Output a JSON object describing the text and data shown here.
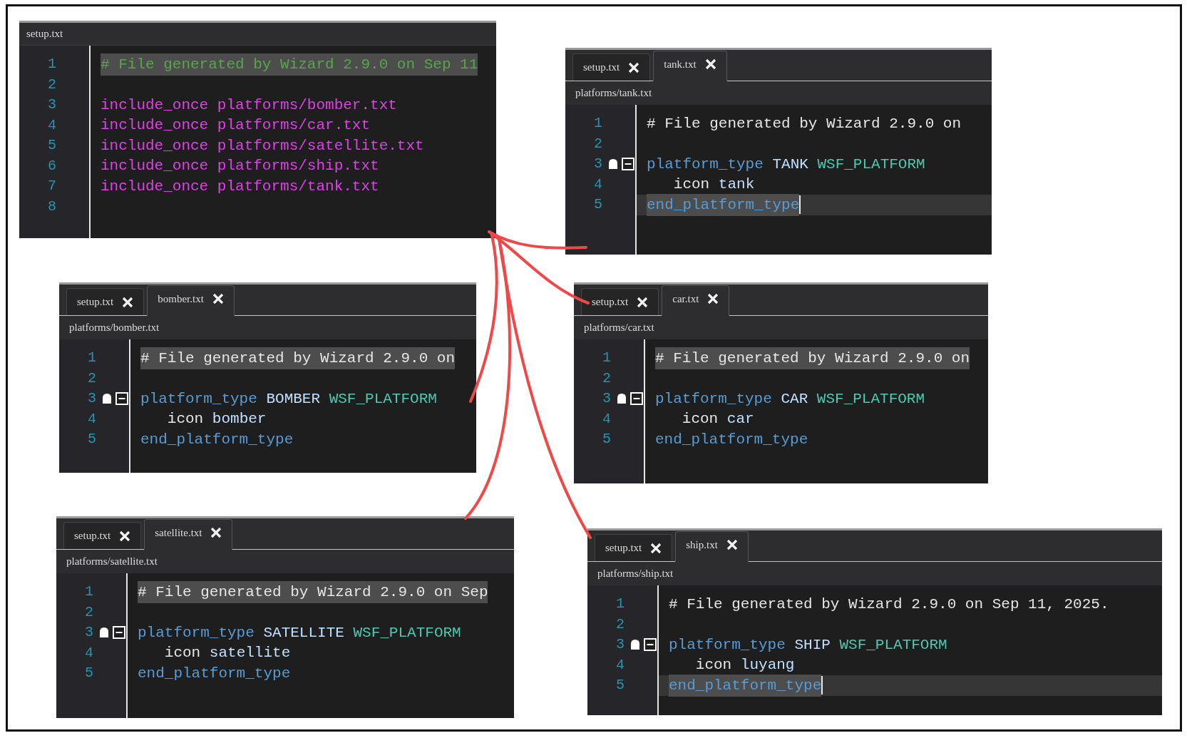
{
  "panels": [
    {
      "title": "setup.txt",
      "lines": [
        {
          "number": "1",
          "selected": true,
          "tokens": [
            {
              "text": "# File generated by Wizard 2.9.0 on Sep 11",
              "kind": "comment"
            }
          ]
        },
        {
          "number": "2"
        },
        {
          "number": "3",
          "tokens": [
            {
              "text": "include_once platforms/bomber.txt",
              "kind": "directive"
            }
          ]
        },
        {
          "number": "4",
          "tokens": [
            {
              "text": "include_once platforms/car.txt",
              "kind": "directive"
            }
          ]
        },
        {
          "number": "5",
          "tokens": [
            {
              "text": "include_once platforms/satellite.txt",
              "kind": "directive"
            }
          ]
        },
        {
          "number": "6",
          "tokens": [
            {
              "text": "include_once platforms/ship.txt",
              "kind": "directive"
            }
          ]
        },
        {
          "number": "7",
          "tokens": [
            {
              "text": "include_once platforms/tank.txt",
              "kind": "directive"
            }
          ]
        },
        {
          "number": "8"
        }
      ]
    },
    {
      "tabs": [
        {
          "label": "setup.txt",
          "selected": false
        },
        {
          "label": "tank.txt",
          "selected": true
        }
      ],
      "path": "platforms/tank.txt",
      "lines": [
        {
          "number": "1",
          "tokens": [
            {
              "text": "# File generated by Wizard 2.9.0 on",
              "kind": "plain"
            }
          ]
        },
        {
          "number": "2"
        },
        {
          "number": "3",
          "marker": true,
          "tokens": [
            {
              "text": "platform_type",
              "kind": "keyword"
            },
            {
              "text": " TANK",
              "kind": "name"
            },
            {
              "text": " WSF_PLATFORM",
              "kind": "type"
            }
          ]
        },
        {
          "number": "4",
          "tokens": [
            {
              "text": "   icon",
              "kind": "plain"
            },
            {
              "text": " tank",
              "kind": "name"
            }
          ]
        },
        {
          "number": "5",
          "selected": true,
          "current": true,
          "tokens": [
            {
              "text": "end_platform_type",
              "kind": "keyword"
            }
          ]
        }
      ]
    },
    {
      "tabs": [
        {
          "label": "setup.txt",
          "selected": false
        },
        {
          "label": "bomber.txt",
          "selected": true
        }
      ],
      "path": "platforms/bomber.txt",
      "lines": [
        {
          "number": "1",
          "selected": true,
          "tokens": [
            {
              "text": "# File generated by Wizard 2.9.0 on",
              "kind": "plain"
            }
          ]
        },
        {
          "number": "2"
        },
        {
          "number": "3",
          "marker": true,
          "tokens": [
            {
              "text": "platform_type",
              "kind": "keyword"
            },
            {
              "text": " BOMBER",
              "kind": "name"
            },
            {
              "text": " WSF_PLATFORM",
              "kind": "type"
            }
          ]
        },
        {
          "number": "4",
          "tokens": [
            {
              "text": "   icon",
              "kind": "plain"
            },
            {
              "text": " bomber",
              "kind": "name"
            }
          ]
        },
        {
          "number": "5",
          "tokens": [
            {
              "text": "end_platform_type",
              "kind": "keyword"
            }
          ]
        }
      ]
    },
    {
      "tabs": [
        {
          "label": "setup.txt",
          "selected": false
        },
        {
          "label": "car.txt",
          "selected": true
        }
      ],
      "path": "platforms/car.txt",
      "lines": [
        {
          "number": "1",
          "selected": true,
          "tokens": [
            {
              "text": "# File generated by Wizard 2.9.0 on",
              "kind": "plain"
            }
          ]
        },
        {
          "number": "2"
        },
        {
          "number": "3",
          "marker": true,
          "tokens": [
            {
              "text": "platform_type",
              "kind": "keyword"
            },
            {
              "text": " CAR",
              "kind": "name"
            },
            {
              "text": " WSF_PLATFORM",
              "kind": "type"
            }
          ]
        },
        {
          "number": "4",
          "tokens": [
            {
              "text": "   icon",
              "kind": "plain"
            },
            {
              "text": " car",
              "kind": "name"
            }
          ]
        },
        {
          "number": "5",
          "tokens": [
            {
              "text": "end_platform_type",
              "kind": "keyword"
            }
          ]
        }
      ]
    },
    {
      "tabs": [
        {
          "label": "setup.txt",
          "selected": false
        },
        {
          "label": "satellite.txt",
          "selected": true
        }
      ],
      "path": "platforms/satellite.txt",
      "lines": [
        {
          "number": "1",
          "selected": true,
          "tokens": [
            {
              "text": "# File generated by Wizard 2.9.0 on Sep",
              "kind": "plain"
            }
          ]
        },
        {
          "number": "2"
        },
        {
          "number": "3",
          "marker": true,
          "tokens": [
            {
              "text": "platform_type",
              "kind": "keyword"
            },
            {
              "text": " SATELLITE",
              "kind": "name"
            },
            {
              "text": " WSF_PLATFORM",
              "kind": "type"
            }
          ]
        },
        {
          "number": "4",
          "tokens": [
            {
              "text": "   icon",
              "kind": "plain"
            },
            {
              "text": " satellite",
              "kind": "name"
            }
          ]
        },
        {
          "number": "5",
          "tokens": [
            {
              "text": "end_platform_type",
              "kind": "keyword"
            }
          ]
        }
      ]
    },
    {
      "tabs": [
        {
          "label": "setup.txt",
          "selected": false
        },
        {
          "label": "ship.txt",
          "selected": true
        }
      ],
      "path": "platforms/ship.txt",
      "lines": [
        {
          "number": "1",
          "tokens": [
            {
              "text": "# File generated by Wizard 2.9.0 on Sep 11, 2025.",
              "kind": "plain"
            }
          ]
        },
        {
          "number": "2"
        },
        {
          "number": "3",
          "marker": true,
          "tokens": [
            {
              "text": "platform_type",
              "kind": "keyword"
            },
            {
              "text": " SHIP",
              "kind": "name"
            },
            {
              "text": " WSF_PLATFORM",
              "kind": "type"
            }
          ]
        },
        {
          "number": "4",
          "tokens": [
            {
              "text": "   icon",
              "kind": "plain"
            },
            {
              "text": " luyang",
              "kind": "name"
            }
          ]
        },
        {
          "number": "5",
          "selected": true,
          "current": true,
          "tokens": [
            {
              "text": "end_platform_type",
              "kind": "keyword"
            }
          ]
        }
      ]
    }
  ]
}
